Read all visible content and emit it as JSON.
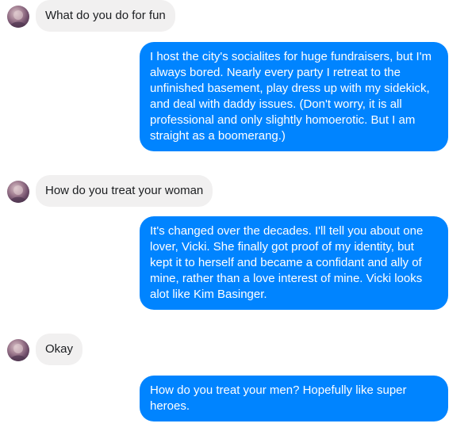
{
  "conversation": {
    "incoming": [
      {
        "text": "What do you do for fun"
      },
      {
        "text": "How do you treat your woman"
      },
      {
        "text": "Okay"
      }
    ],
    "outgoing": [
      {
        "lines": [
          "I host the city's socialites for huge fundraisers, but I'm",
          "always bored. Nearly every party I retreat to the",
          "unfinished basement, play dress up with my sidekick,",
          "and deal with daddy issues. (Don't worry, it is all",
          "professional and only slightly homoerotic. But I am",
          "straight as a boomerang.)"
        ]
      },
      {
        "lines": [
          "It's changed over the decades. I'll tell you about one",
          "lover, Vicki. She finally got proof of my identity, but",
          "kept it to herself and became a confidant and ally of",
          "mine, rather than a love interest of mine. Vicki looks",
          "alot like Kim Basinger."
        ]
      },
      {
        "lines": [
          "How do you treat your men? Hopefully like super",
          "heroes."
        ]
      }
    ]
  },
  "colors": {
    "outgoing_bubble": "#0084ff",
    "incoming_bubble": "#f1f0f0",
    "incoming_text": "#1c1e21",
    "outgoing_text": "#ffffff"
  },
  "icons": {
    "avatar": "contact-avatar-icon"
  }
}
